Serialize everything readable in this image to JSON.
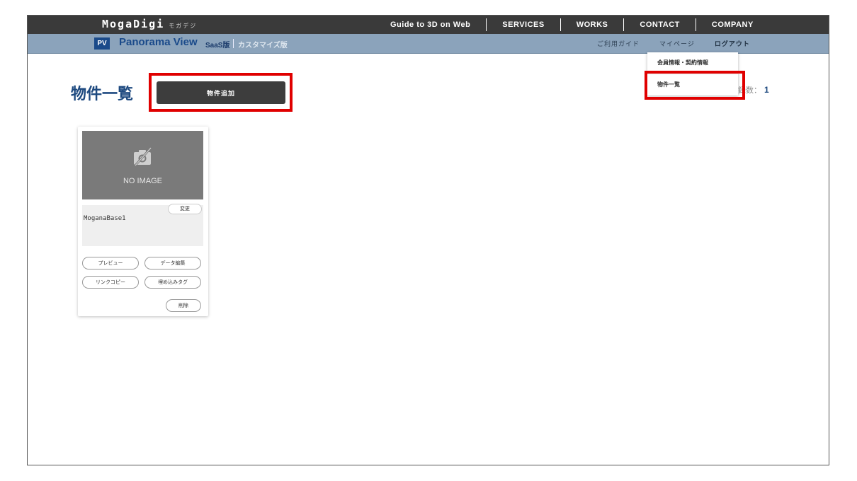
{
  "header": {
    "brand": "MogaDigi",
    "brand_sub": "モガデジ",
    "nav": [
      "Guide to 3D on Web",
      "SERVICES",
      "WORKS",
      "CONTACT",
      "COMPANY"
    ]
  },
  "subheader": {
    "badge": "PV",
    "product": "Panorama View",
    "edition": "SaaS版",
    "custom": "カスタマイズ版",
    "nav": {
      "guide": "ご利用ガイド",
      "mypage": "マイページ",
      "logout": "ログアウト"
    }
  },
  "dropdown": {
    "items": [
      "会員情報・契約情報",
      "物件一覧"
    ]
  },
  "main": {
    "title": "物件一覧",
    "add_button": "物件追加",
    "count_label": "録数：",
    "count_value": "1"
  },
  "card": {
    "placeholder": "NO IMAGE",
    "change_button": "変更",
    "name": "MoganaBase1",
    "buttons": {
      "preview": "プレビュー",
      "edit": "データ編集",
      "copy_link": "リンクコピー",
      "embed": "埋め込みタグ",
      "delete": "削除"
    }
  },
  "colors": {
    "topbar": "#3a3a3a",
    "subbar": "#8ba3bb",
    "accent": "#1e4a80",
    "highlight": "#e00000"
  }
}
